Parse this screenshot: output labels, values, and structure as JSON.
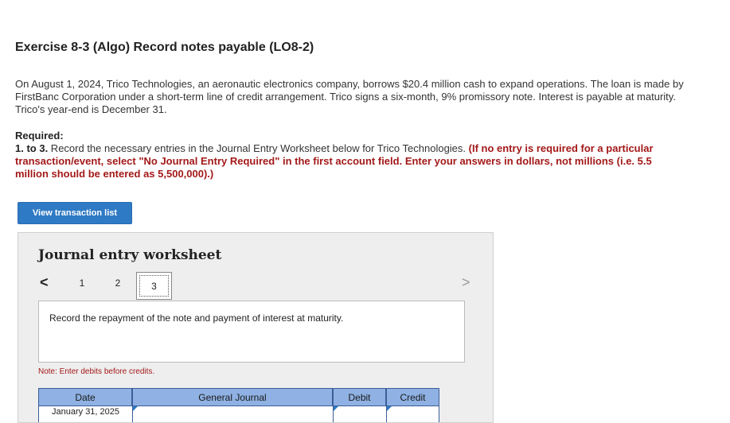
{
  "exercise": {
    "title": "Exercise 8-3 (Algo) Record notes payable (LO8-2)",
    "intro": "On August 1, 2024, Trico Technologies, an aeronautic electronics company, borrows $20.4 million cash to expand operations. The loan is made by FirstBanc Corporation under a short-term line of credit arrangement. Trico signs a six-month, 9% promissory note. Interest is payable at maturity. Trico's year-end is December 31."
  },
  "required": {
    "heading": "Required:",
    "number": "1. to 3.",
    "text": " Record the necessary entries in the Journal Entry Worksheet below for Trico Technologies. ",
    "instruction": "(If no entry is required for a particular transaction/event, select \"No Journal Entry Required\" in the first account field. Enter your answers in dollars, not millions (i.e. 5.5 million should be entered as 5,500,000).)"
  },
  "buttons": {
    "view_transactions": "View transaction list"
  },
  "worksheet": {
    "title": "Journal entry worksheet",
    "prev_icon": "<",
    "next_icon": ">",
    "pages": [
      "1",
      "2",
      "3"
    ],
    "active_page": "3",
    "description": "Record the repayment of the note and payment of interest at maturity.",
    "note": "Note: Enter debits before credits.",
    "table": {
      "headers": [
        "Date",
        "General Journal",
        "Debit",
        "Credit"
      ],
      "rows": [
        {
          "date": "January 31, 2025",
          "account": "",
          "debit": "",
          "credit": ""
        }
      ]
    }
  },
  "colors": {
    "button_blue": "#2f7ac4",
    "instruction_red": "#a31919",
    "table_header": "#8fb1e3"
  }
}
